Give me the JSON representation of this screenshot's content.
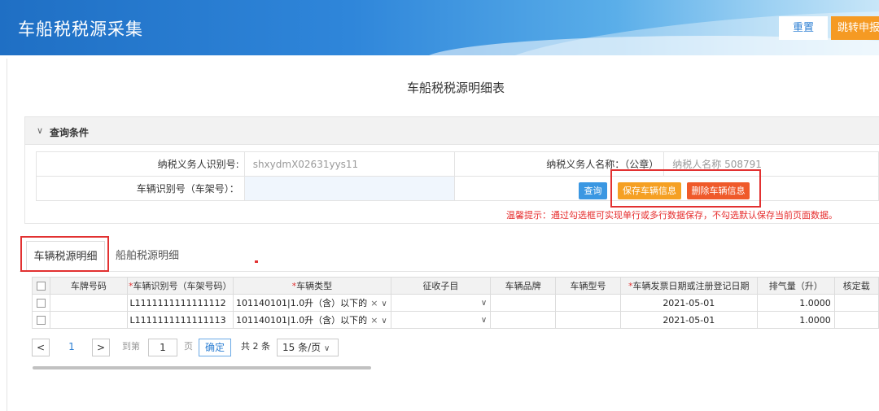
{
  "header": {
    "title": "车船税税源采集",
    "reset_label": "重置",
    "jump_label": "跳转申报"
  },
  "page_title": "车船税税源明细表",
  "query": {
    "panel_label": "查询条件",
    "taxpayer_id_label": "纳税义务人识别号:",
    "taxpayer_id_value": "shxydmX02631yys11",
    "taxpayer_name_label": "纳税义务人名称：（公章）",
    "taxpayer_name_value": "纳税人名称 508791",
    "vin_label": "车辆识别号（车架号）：",
    "vin_value": "",
    "query_button": "查询",
    "save_button": "保存车辆信息",
    "delete_button": "删除车辆信息",
    "tip": "温馨提示：通过勾选框可实现单行或多行数据保存，不勾选默认保存当前页面数据。"
  },
  "tabs": [
    {
      "label": "车辆税源明细"
    },
    {
      "label": "船舶税源明细"
    }
  ],
  "table": {
    "columns": [
      {
        "label": "车牌号码",
        "required": false
      },
      {
        "label": "车辆识别号（车架号码）",
        "required": true
      },
      {
        "label": "车辆类型",
        "required": true
      },
      {
        "label": "征收子目",
        "required": false
      },
      {
        "label": "车辆品牌",
        "required": false
      },
      {
        "label": "车辆型号",
        "required": false
      },
      {
        "label": "车辆发票日期或注册登记日期",
        "required": true
      },
      {
        "label": "排气量（升）",
        "required": false
      },
      {
        "label": "核定载",
        "required": false
      }
    ],
    "rows": [
      {
        "plate": "",
        "vin": "L1111111111111112",
        "type": "101140101|1.0升（含）以下的",
        "subitem": "",
        "brand": "",
        "model": "",
        "date": "2021-05-01",
        "displacement": "1.0000",
        "capacity": ""
      },
      {
        "plate": "",
        "vin": "L1111111111111113",
        "type": "101140101|1.0升（含）以下的",
        "subitem": "",
        "brand": "",
        "model": "",
        "date": "2021-05-01",
        "displacement": "1.0000",
        "capacity": ""
      }
    ]
  },
  "pagination": {
    "prev": "<",
    "current_page": "1",
    "next": ">",
    "goto_label": "到第",
    "goto_value": "1",
    "page_unit": "页",
    "confirm": "确定",
    "total": "共 2 条",
    "page_size": "15 条/页"
  },
  "colors": {
    "banner_start": "#1f6fc4",
    "accent_blue": "#3a97e2",
    "orange": "#f5a023",
    "red": "#ef5a2a",
    "highlight_box": "#e23131"
  }
}
